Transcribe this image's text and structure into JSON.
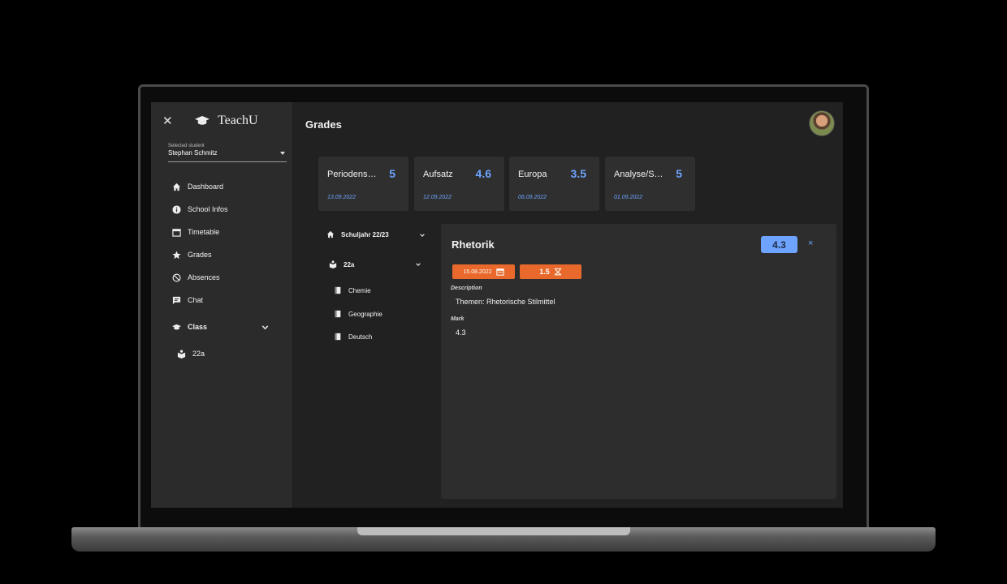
{
  "app": {
    "name": "TeachU"
  },
  "student": {
    "label": "Selected student",
    "name": "Stephan Schmitz"
  },
  "nav": {
    "items": [
      {
        "label": "Dashboard",
        "icon": "home-icon"
      },
      {
        "label": "School Infos",
        "icon": "info-icon"
      },
      {
        "label": "Timetable",
        "icon": "calendar-icon"
      },
      {
        "label": "Grades",
        "icon": "star-icon"
      },
      {
        "label": "Absences",
        "icon": "block-icon"
      },
      {
        "label": "Chat",
        "icon": "chat-icon"
      }
    ],
    "class_section": {
      "label": "Class",
      "icon": "graduation-cap-icon"
    },
    "class_items": [
      {
        "label": "22a",
        "icon": "class-icon"
      }
    ]
  },
  "page": {
    "title": "Grades"
  },
  "grade_cards": [
    {
      "title": "Periodensy…",
      "value": "5",
      "date": "13.09.2022"
    },
    {
      "title": "Aufsatz",
      "value": "4.6",
      "date": "12.09.2022"
    },
    {
      "title": "Europa",
      "value": "3.5",
      "date": "06.09.2022"
    },
    {
      "title": "Analyse/Sy…",
      "value": "5",
      "date": "01.09.2022"
    }
  ],
  "tree": {
    "year": "Schuljahr 22/23",
    "class": "22a",
    "subjects": [
      "Chemie",
      "Geographie",
      "Deutsch"
    ]
  },
  "detail": {
    "title": "Rhetorik",
    "mark_badge": "4.3",
    "close": "×",
    "date": "15.08.2022",
    "weight": "1.5",
    "description_label": "Description",
    "description": "Themen: Rhetorische Stilmittel",
    "mark_label": "Mark",
    "mark": "4.3"
  },
  "colors": {
    "accent": "#6ea4ff",
    "chip": "#e8692b",
    "sidebar": "#2b2b2b",
    "background": "#212121"
  }
}
